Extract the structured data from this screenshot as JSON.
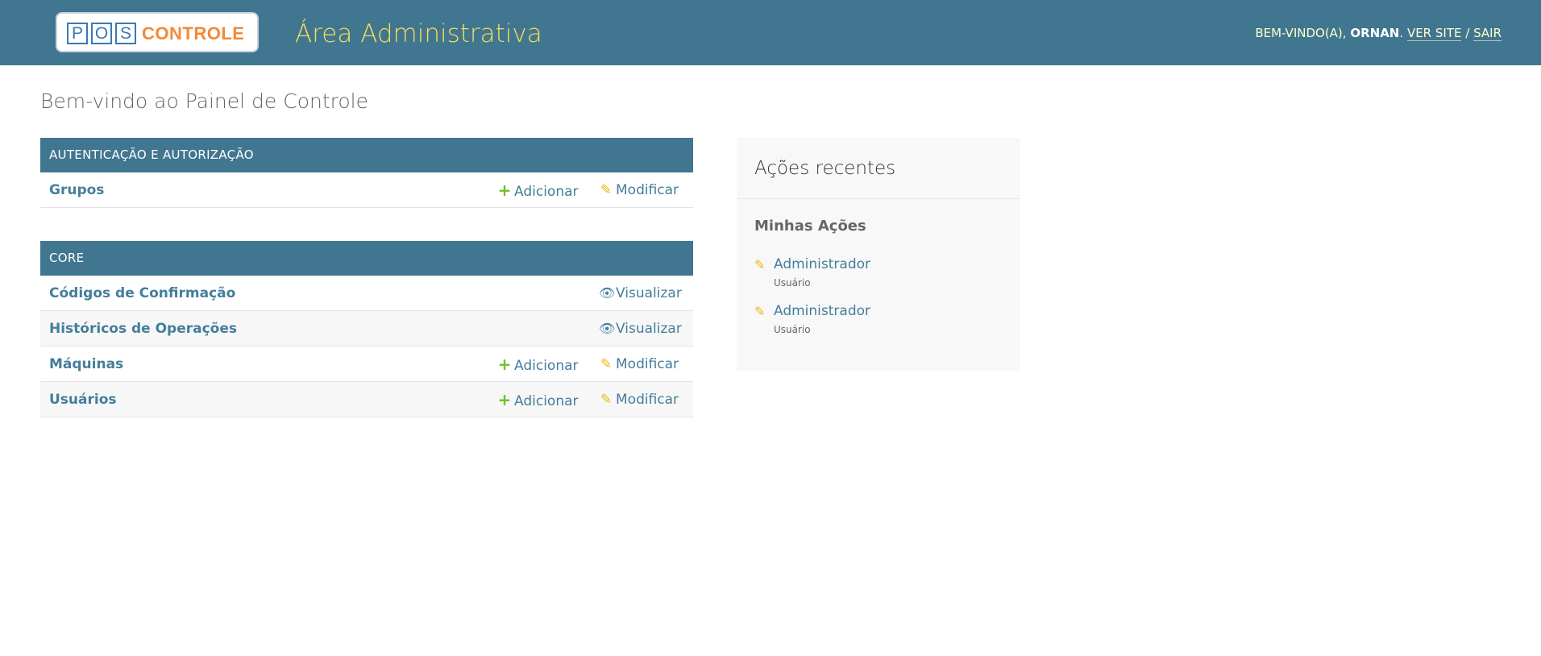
{
  "header": {
    "logo": {
      "letters": [
        "P",
        "O",
        "S"
      ],
      "word": "CONTROLE"
    },
    "site_name": "Área Administrativa",
    "user_tools": {
      "welcome": "BEM-VINDO(A),",
      "username": "ORNAN",
      "period": ".",
      "view_site": "VER SITE",
      "separator": "/",
      "logout": "SAIR"
    }
  },
  "page": {
    "title": "Bem-vindo ao Painel de Controle"
  },
  "modules": [
    {
      "caption": "AUTENTICAÇÃO E AUTORIZAÇÃO",
      "rows": [
        {
          "name": "Grupos",
          "actions": [
            "Adicionar",
            "Modificar"
          ]
        }
      ]
    },
    {
      "caption": "CORE",
      "rows": [
        {
          "name": "Códigos de Confirmação",
          "actions": [
            "Visualizar"
          ]
        },
        {
          "name": "Históricos de Operações",
          "actions": [
            "Visualizar"
          ]
        },
        {
          "name": "Máquinas",
          "actions": [
            "Adicionar",
            "Modificar"
          ]
        },
        {
          "name": "Usuários",
          "actions": [
            "Adicionar",
            "Modificar"
          ]
        }
      ]
    }
  ],
  "icons": {
    "add": "plus-icon",
    "edit": "pencil-icon",
    "view": "eye-icon"
  },
  "recent_actions": {
    "title": "Ações recentes",
    "subtitle": "Minhas Ações",
    "items": [
      {
        "label": "Administrador",
        "type": "Usuário",
        "icon": "pencil-icon"
      },
      {
        "label": "Administrador",
        "type": "Usuário",
        "icon": "pencil-icon"
      }
    ]
  },
  "colors": {
    "header_bg": "#417690",
    "site_name": "#f5dd5d",
    "link": "#447e9b",
    "add_icon": "#70bf2b",
    "edit_icon": "#efb80b",
    "logo_blue": "#3a78b9",
    "logo_orange": "#f08a3a"
  }
}
